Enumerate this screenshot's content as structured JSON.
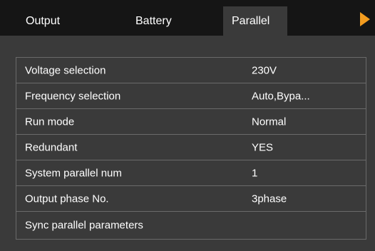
{
  "tabs": {
    "output": "Output",
    "battery": "Battery",
    "parallel": "Parallel"
  },
  "accent_color": "#f39c1f",
  "settings": [
    {
      "label": "Voltage selection",
      "value": "230V"
    },
    {
      "label": "Frequency selection",
      "value": "Auto,Bypa..."
    },
    {
      "label": "Run mode",
      "value": "Normal"
    },
    {
      "label": "Redundant",
      "value": "YES"
    },
    {
      "label": "System parallel num",
      "value": "1"
    },
    {
      "label": "Output phase No.",
      "value": "3phase"
    },
    {
      "label": "Sync parallel parameters",
      "value": ""
    }
  ]
}
